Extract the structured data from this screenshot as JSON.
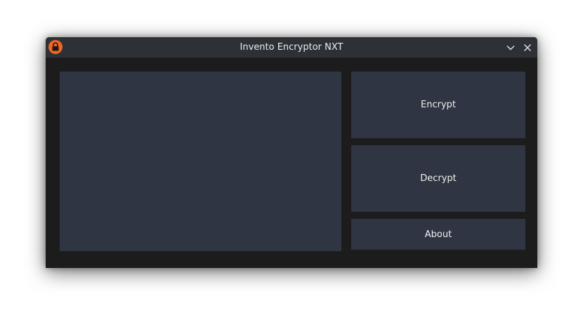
{
  "window": {
    "title": "Invento Encryptor NXT"
  },
  "titlebar": {
    "app_icon": "padlock-icon",
    "minimize_icon": "chevron-down-icon",
    "close_icon": "close-icon"
  },
  "main": {
    "text_value": "",
    "buttons": {
      "encrypt_label": "Encrypt",
      "decrypt_label": "Decrypt",
      "about_label": "About"
    }
  },
  "colors": {
    "window_bg": "#1c1c1c",
    "titlebar_bg": "#2d3035",
    "panel_bg": "#2f3542",
    "icon_accent": "#f26522",
    "text": "#f0f0f0"
  }
}
